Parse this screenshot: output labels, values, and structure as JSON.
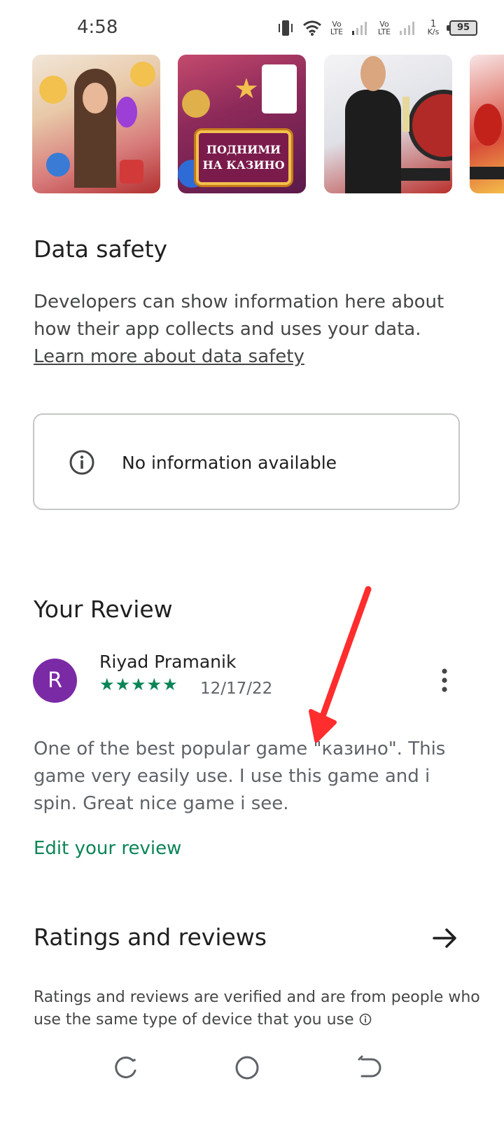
{
  "status_bar": {
    "time": "4:58",
    "network_1": "Vo LTE",
    "network_2": "Vo LTE",
    "speed_value": "1",
    "speed_unit": "K/s",
    "battery": "95"
  },
  "carousel": {
    "screenshot_2_sign_line1": "ПОДНИМИ",
    "screenshot_2_sign_line2": "НА КАЗИНО"
  },
  "data_safety": {
    "title": "Data safety",
    "description": "Developers can show information here about how their app collects and uses your data. ",
    "link_text": "Learn more about data safety",
    "info_card_text": "No information available"
  },
  "your_review": {
    "title": "Your Review",
    "avatar_letter": "R",
    "reviewer_name": "Riyad Pramanik",
    "stars": "★★★★★",
    "rating": 5,
    "date": "12/17/22",
    "text": "One of the best popular game \"казино\". This game very easily use. I use this game and i spin. Great nice game i see.",
    "edit_link": "Edit your review"
  },
  "ratings": {
    "title": "Ratings and reviews",
    "description": "Ratings and reviews are verified and are from people who use the same type of device that you use"
  },
  "colors": {
    "accent_green": "#0b8457",
    "avatar_purple": "#7b2aa6",
    "annotation_red": "#ff2d2d"
  },
  "icons": [
    "vibrate-icon",
    "wifi-icon",
    "signal-icon",
    "battery-icon",
    "info-icon",
    "more-vert-icon",
    "arrow-right-icon",
    "recents-nav-icon",
    "home-nav-icon",
    "back-nav-icon"
  ]
}
